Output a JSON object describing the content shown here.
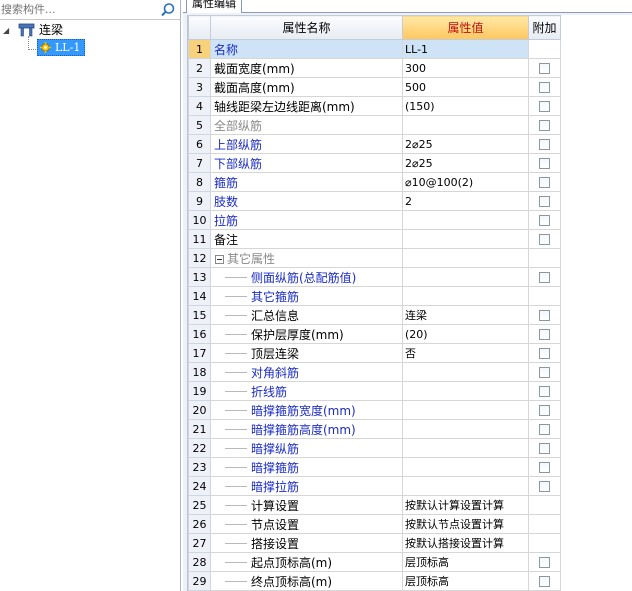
{
  "left_panel": {
    "search": {
      "placeholder": "搜索构件..."
    },
    "tree": {
      "root_label": "连梁",
      "child_label": "LL-1"
    }
  },
  "right_panel": {
    "tab_label": "属性编辑",
    "headers": {
      "name": "属性名称",
      "value": "属性值",
      "extra": "附加"
    },
    "rows": [
      {
        "n": "1",
        "name": "名称",
        "value": "LL-1",
        "cb": false,
        "color": "blue",
        "indent": 0,
        "selected": true
      },
      {
        "n": "2",
        "name": "截面宽度(mm)",
        "value": "300",
        "cb": true,
        "color": "black",
        "indent": 0
      },
      {
        "n": "3",
        "name": "截面高度(mm)",
        "value": "500",
        "cb": true,
        "color": "black",
        "indent": 0
      },
      {
        "n": "4",
        "name": "轴线距梁左边线距离(mm)",
        "value": "(150)",
        "cb": true,
        "color": "black",
        "indent": 0
      },
      {
        "n": "5",
        "name": "全部纵筋",
        "value": "",
        "cb": true,
        "color": "gray",
        "indent": 0
      },
      {
        "n": "6",
        "name": "上部纵筋",
        "value": "2⌀25",
        "cb": true,
        "color": "blue",
        "indent": 0
      },
      {
        "n": "7",
        "name": "下部纵筋",
        "value": "2⌀25",
        "cb": true,
        "color": "blue",
        "indent": 0
      },
      {
        "n": "8",
        "name": "箍筋",
        "value": "⌀10@100(2)",
        "cb": true,
        "color": "blue",
        "indent": 0
      },
      {
        "n": "9",
        "name": "肢数",
        "value": "2",
        "cb": true,
        "color": "blue",
        "indent": 0
      },
      {
        "n": "10",
        "name": "拉筋",
        "value": "",
        "cb": true,
        "color": "blue",
        "indent": 0
      },
      {
        "n": "11",
        "name": "备注",
        "value": "",
        "cb": true,
        "color": "black",
        "indent": 0
      },
      {
        "n": "12",
        "name": "其它属性",
        "value": "",
        "cb": false,
        "color": "gray",
        "indent": -1
      },
      {
        "n": "13",
        "name": "侧面纵筋(总配筋值)",
        "value": "",
        "cb": true,
        "color": "blue",
        "indent": 1
      },
      {
        "n": "14",
        "name": "其它箍筋",
        "value": "",
        "cb": false,
        "color": "blue",
        "indent": 1
      },
      {
        "n": "15",
        "name": "汇总信息",
        "value": "连梁",
        "cb": true,
        "color": "black",
        "indent": 1
      },
      {
        "n": "16",
        "name": "保护层厚度(mm)",
        "value": "(20)",
        "cb": true,
        "color": "black",
        "indent": 1
      },
      {
        "n": "17",
        "name": "顶层连梁",
        "value": "否",
        "cb": true,
        "color": "black",
        "indent": 1
      },
      {
        "n": "18",
        "name": "对角斜筋",
        "value": "",
        "cb": true,
        "color": "blue",
        "indent": 1
      },
      {
        "n": "19",
        "name": "折线筋",
        "value": "",
        "cb": true,
        "color": "blue",
        "indent": 1
      },
      {
        "n": "20",
        "name": "暗撑箍筋宽度(mm)",
        "value": "",
        "cb": true,
        "color": "blue",
        "indent": 1
      },
      {
        "n": "21",
        "name": "暗撑箍筋高度(mm)",
        "value": "",
        "cb": true,
        "color": "blue",
        "indent": 1
      },
      {
        "n": "22",
        "name": "暗撑纵筋",
        "value": "",
        "cb": true,
        "color": "blue",
        "indent": 1
      },
      {
        "n": "23",
        "name": "暗撑箍筋",
        "value": "",
        "cb": true,
        "color": "blue",
        "indent": 1
      },
      {
        "n": "24",
        "name": "暗撑拉筋",
        "value": "",
        "cb": true,
        "color": "blue",
        "indent": 1
      },
      {
        "n": "25",
        "name": "计算设置",
        "value": "按默认计算设置计算",
        "cb": false,
        "color": "black",
        "indent": 1
      },
      {
        "n": "26",
        "name": "节点设置",
        "value": "按默认节点设置计算",
        "cb": false,
        "color": "black",
        "indent": 1
      },
      {
        "n": "27",
        "name": "搭接设置",
        "value": "按默认搭接设置计算",
        "cb": false,
        "color": "black",
        "indent": 1
      },
      {
        "n": "28",
        "name": "起点顶标高(m)",
        "value": "层顶标高",
        "cb": true,
        "color": "black",
        "indent": 1
      },
      {
        "n": "29",
        "name": "终点顶标高(m)",
        "value": "层顶标高",
        "cb": true,
        "color": "black",
        "indent": 1
      }
    ]
  },
  "colors": {
    "accent_header": "#ffc65e",
    "selection": "#3399ff",
    "blue_text": "#1a2bc6",
    "gray_text": "#8a8a8a"
  }
}
